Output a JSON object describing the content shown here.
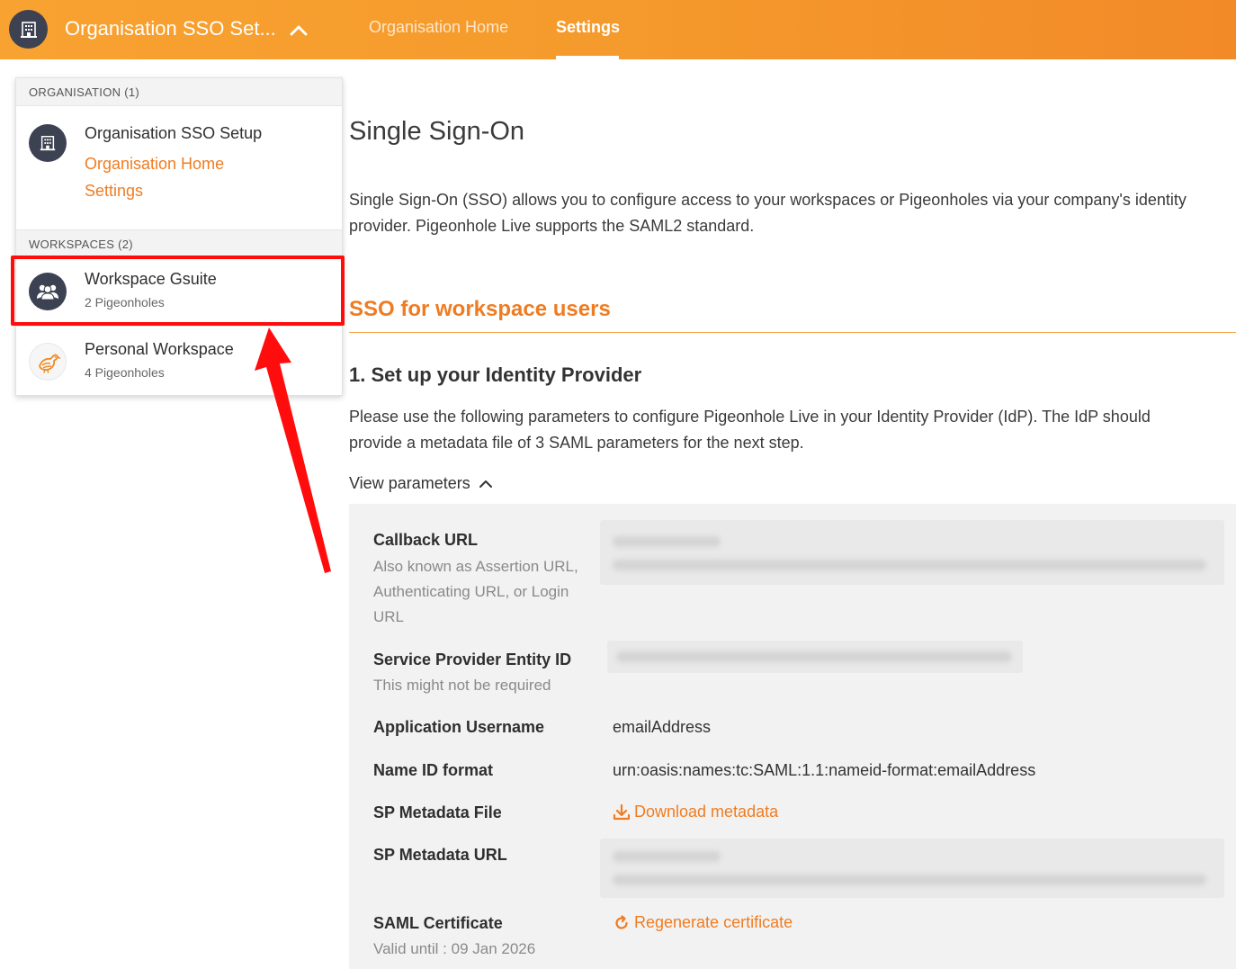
{
  "header": {
    "org_title": "Organisation SSO Set...",
    "tabs": [
      {
        "label": "Organisation Home",
        "active": false
      },
      {
        "label": "Settings",
        "active": true
      }
    ]
  },
  "dropdown": {
    "org_section": "ORGANISATION (1)",
    "org_name": "Organisation SSO Setup",
    "org_links": [
      "Organisation Home",
      "Settings"
    ],
    "ws_section": "WORKSPACES (2)",
    "workspaces": [
      {
        "name": "Workspace Gsuite",
        "count": "2 Pigeonholes",
        "icon": "people-icon"
      },
      {
        "name": "Personal Workspace",
        "count": "4 Pigeonholes",
        "icon": "pigeon-icon"
      }
    ]
  },
  "main": {
    "title": "Single Sign-On",
    "intro": "Single Sign-On (SSO) allows you to configure access to your workspaces or Pigeonholes via your company's identity provider. Pigeonhole Live supports the SAML2 standard.",
    "section_title": "SSO for workspace users",
    "step_title": "1. Set up your Identity Provider",
    "step_desc": "Please use the following parameters to configure Pigeonhole Live in your Identity Provider (IdP). The IdP should provide a metadata file of 3 SAML parameters for the next step.",
    "view_params": "View parameters",
    "params": {
      "callback_label": "Callback URL",
      "callback_sub": "Also known as Assertion URL, Authenticating URL, or Login URL",
      "entity_label": "Service Provider Entity ID",
      "entity_sub": "This might not be required",
      "username_label": "Application Username",
      "username_value": "emailAddress",
      "nameid_label": "Name ID format",
      "nameid_value": "urn:oasis:names:tc:SAML:1.1:nameid-format:emailAddress",
      "metafile_label": "SP Metadata File",
      "metafile_link": "Download metadata",
      "metaurl_label": "SP Metadata URL",
      "cert_label": "SAML Certificate",
      "cert_sub": "Valid until : 09 Jan 2026",
      "cert_link": "Regenerate certificate"
    }
  },
  "colors": {
    "accent": "#ef7c22",
    "topbar": "#f59a2c",
    "highlight": "#ff0d0d",
    "avatar": "#3c4252"
  }
}
